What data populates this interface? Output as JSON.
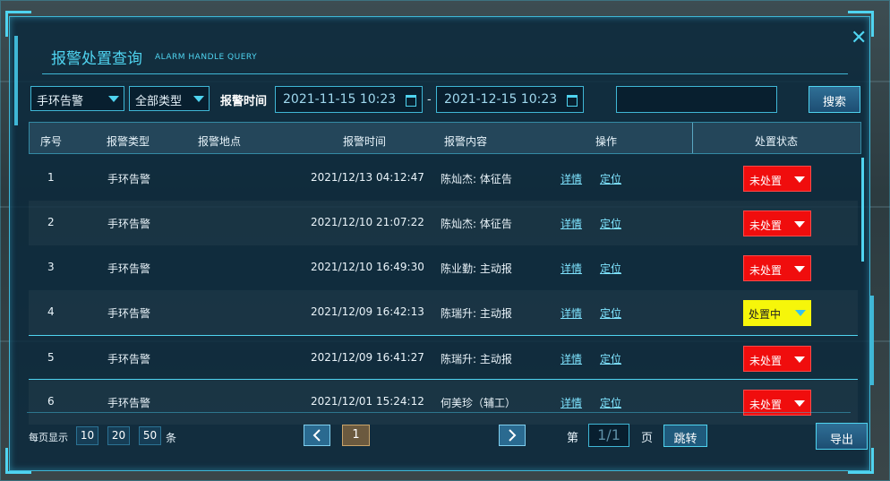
{
  "dialog": {
    "title": "报警处置查询",
    "subtitle": "ALARM HANDLE QUERY",
    "close_icon": "close-icon"
  },
  "filters": {
    "device_type": "手环告警",
    "alarm_type": "全部类型",
    "time_label": "报警时间",
    "start_time": "2021-11-15 10:23",
    "separator": "-",
    "end_time": "2021-12-15 10:23",
    "keyword": "",
    "search_label": "搜索"
  },
  "table": {
    "headers": [
      "序号",
      "报警类型",
      "报警地点",
      "报警时间",
      "报警内容",
      "操作",
      "处置状态"
    ],
    "rows": [
      {
        "index": "1",
        "type": "手环告警",
        "location": "",
        "time": "2021/12/13 04:12:47",
        "content": "陈灿杰: 体征告",
        "detail": "详情",
        "locate": "定位",
        "status": "未处置",
        "status_color": "#f00d0d"
      },
      {
        "index": "2",
        "type": "手环告警",
        "location": "",
        "time": "2021/12/10 21:07:22",
        "content": "陈灿杰: 体征告",
        "detail": "详情",
        "locate": "定位",
        "status": "未处置",
        "status_color": "#f00d0d"
      },
      {
        "index": "3",
        "type": "手环告警",
        "location": "",
        "time": "2021/12/10 16:49:30",
        "content": "陈业勤: 主动报",
        "detail": "详情",
        "locate": "定位",
        "status": "未处置",
        "status_color": "#f00d0d"
      },
      {
        "index": "4",
        "type": "手环告警",
        "location": "",
        "time": "2021/12/09 16:42:13",
        "content": "陈瑞升: 主动报",
        "detail": "详情",
        "locate": "定位",
        "status": "处置中",
        "status_color": "#f6f60a"
      },
      {
        "index": "5",
        "type": "手环告警",
        "location": "",
        "time": "2021/12/09 16:41:27",
        "content": "陈瑞升: 主动报",
        "detail": "详情",
        "locate": "定位",
        "status": "未处置",
        "status_color": "#f00d0d"
      },
      {
        "index": "6",
        "type": "手环告警",
        "location": "",
        "time": "2021/12/01 15:24:12",
        "content": "何美珍（辅工）",
        "detail": "详情",
        "locate": "定位",
        "status": "未处置",
        "status_color": "#f00d0d"
      }
    ]
  },
  "pagination": {
    "per_page_label": "每页显示",
    "sizes": [
      "10",
      "20",
      "50"
    ],
    "unit": "条",
    "current_page": "1",
    "page_prefix": "第",
    "page_value": "1/1",
    "page_suffix": "页",
    "jump_label": "跳转",
    "export_label": "导出"
  },
  "colors": {
    "accent": "#4fd4f0",
    "unhandled": "#f00d0d",
    "in_progress": "#f6f60a"
  }
}
